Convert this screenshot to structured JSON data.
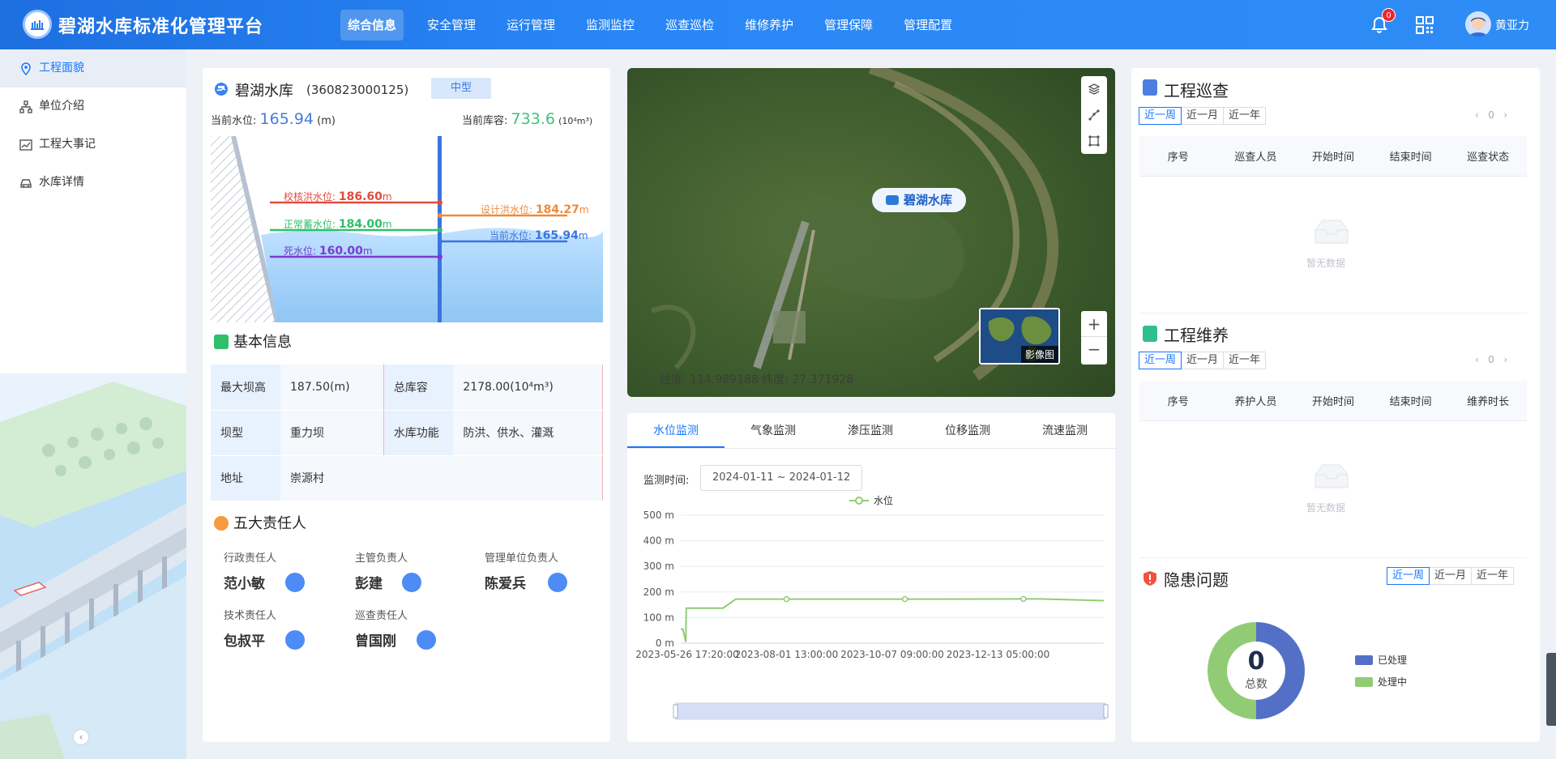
{
  "header": {
    "title": "碧湖水库标准化管理平台",
    "nav": [
      "综合信息",
      "安全管理",
      "运行管理",
      "监测监控",
      "巡查巡检",
      "维修养护",
      "管理保障",
      "管理配置"
    ],
    "active_nav_index": 0,
    "notification_count": "0",
    "username": "黄亚力"
  },
  "sidebar": {
    "items": [
      {
        "label": "工程面貌",
        "icon": "location-pin-icon",
        "active": true
      },
      {
        "label": "单位介绍",
        "icon": "org-chart-icon",
        "active": false
      },
      {
        "label": "工程大事记",
        "icon": "trend-chart-icon",
        "active": false
      },
      {
        "label": "水库详情",
        "icon": "car-icon",
        "active": false
      }
    ]
  },
  "overview": {
    "name": "碧湖水库",
    "code": "(360823000125)",
    "scale_tag": "中型",
    "level_label": "当前水位:",
    "level_value": "165.94",
    "level_unit": "(m)",
    "storage_label": "当前库容:",
    "storage_value": "733.6",
    "storage_unit": "(10⁴m³)",
    "levels": {
      "check_flood_label": "校核洪水位:",
      "check_flood_value": "186.60",
      "normal_label": "正常蓄水位:",
      "normal_value": "184.00",
      "dead_label": "死水位:",
      "dead_value": "160.00",
      "design_flood_label": "设计洪水位:",
      "design_flood_value": "184.27",
      "current_label": "当前水位:",
      "current_value": "165.94",
      "unit": "m"
    }
  },
  "basic_info": {
    "title": "基本信息",
    "rows": [
      {
        "k1": "最大坝高",
        "v1": "187.50(m)",
        "k2": "总库容",
        "v2": "2178.00(10⁴m³)"
      },
      {
        "k1": "坝型",
        "v1": "重力坝",
        "k2": "水库功能",
        "v2": "防洪、供水、灌溉"
      },
      {
        "k1": "地址",
        "v1": "崇源村",
        "k2": "",
        "v2": ""
      }
    ]
  },
  "responsible": {
    "title": "五大责任人",
    "people": [
      {
        "role": "行政责任人",
        "name": "范小敏"
      },
      {
        "role": "主管负责人",
        "name": "彭建"
      },
      {
        "role": "管理单位负责人",
        "name": "陈爱兵"
      },
      {
        "role": "技术责任人",
        "name": "包叔平"
      },
      {
        "role": "巡查责任人",
        "name": "曾国刚"
      }
    ]
  },
  "map": {
    "marker_label": "碧湖水库",
    "thumbnail_label": "影像图",
    "coords_text": "经度: 114.989188 纬度: 27.371928"
  },
  "monitor": {
    "tabs": [
      "水位监测",
      "气象监测",
      "渗压监测",
      "位移监测",
      "流速监测"
    ],
    "active_tab": 0,
    "time_label": "监测时间:",
    "time_range": "2024-01-11 ~ 2024-01-12"
  },
  "chart_data": {
    "type": "line",
    "legend": "水位",
    "ylim": [
      0,
      500
    ],
    "y_ticks": [
      "0 m",
      "100 m",
      "200 m",
      "300 m",
      "400 m",
      "500 m"
    ],
    "x_ticks": [
      "2023-05-26 17:20:00",
      "2023-08-01 13:00:00",
      "2023-10-07 09:00:00",
      "2023-12-13 05:00:00"
    ],
    "series": [
      {
        "name": "水位",
        "x": [
          0,
          0.005,
          0.012,
          0.013,
          0.1,
          0.13,
          0.25,
          0.6,
          0.85,
          1.0
        ],
        "values": [
          55,
          55,
          5,
          137,
          137,
          172,
          172,
          172,
          173,
          166
        ]
      }
    ],
    "markers_at_x": [
      0.25,
      0.53,
      0.81
    ]
  },
  "inspection": {
    "title": "工程巡查",
    "ranges": [
      "近一周",
      "近一月",
      "近一年"
    ],
    "active_range": 0,
    "page": "0",
    "columns": [
      "序号",
      "巡查人员",
      "开始时间",
      "结束时间",
      "巡查状态"
    ],
    "empty_text": "暂无数据"
  },
  "maintenance": {
    "title": "工程维养",
    "ranges": [
      "近一周",
      "近一月",
      "近一年"
    ],
    "active_range": 0,
    "page": "0",
    "columns": [
      "序号",
      "养护人员",
      "开始时间",
      "结束时间",
      "维养时长"
    ],
    "empty_text": "暂无数据"
  },
  "hazards": {
    "title": "隐患问题",
    "ranges": [
      "近一周",
      "近一月",
      "近一年"
    ],
    "active_range": 0,
    "total": "0",
    "total_label": "总数",
    "legend": [
      {
        "label": "已处理",
        "color": "#5470c6"
      },
      {
        "label": "处理中",
        "color": "#91cc75"
      }
    ]
  }
}
